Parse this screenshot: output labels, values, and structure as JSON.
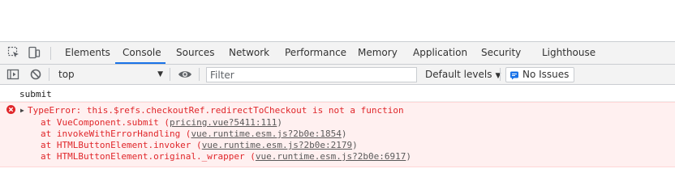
{
  "devtools": {
    "tabs": [
      "Elements",
      "Console",
      "Sources",
      "Network",
      "Performance",
      "Memory",
      "Application",
      "Security",
      "Lighthouse"
    ],
    "active_tab": "Console"
  },
  "toolbar": {
    "context": "top",
    "filter_placeholder": "Filter",
    "levels_label": "Default levels",
    "issues_label": "No Issues"
  },
  "console": {
    "log_text": "submit",
    "error": {
      "message": "TypeError: this.$refs.checkoutRef.redirectToCheckout is not a function",
      "frames": [
        {
          "prefix": "at VueComponent.submit (",
          "link": "pricing.vue?5411:111",
          "suffix": ")"
        },
        {
          "prefix": "at invokeWithErrorHandling (",
          "link": "vue.runtime.esm.js?2b0e:1854",
          "suffix": ")"
        },
        {
          "prefix": "at HTMLButtonElement.invoker (",
          "link": "vue.runtime.esm.js?2b0e:2179",
          "suffix": ")"
        },
        {
          "prefix": "at HTMLButtonElement.original._wrapper (",
          "link": "vue.runtime.esm.js?2b0e:6917",
          "suffix": ")"
        }
      ]
    }
  },
  "colors": {
    "accent": "#1a73e8",
    "error_text": "#e0262a",
    "error_bg": "#fff0f0"
  },
  "icons": [
    "inspect-element-icon",
    "device-toolbar-icon",
    "sidebar-toggle-icon",
    "clear-console-icon",
    "eye-icon",
    "chevron-down-icon",
    "issue-flag-icon",
    "error-circle-icon",
    "expand-triangle-icon"
  ]
}
